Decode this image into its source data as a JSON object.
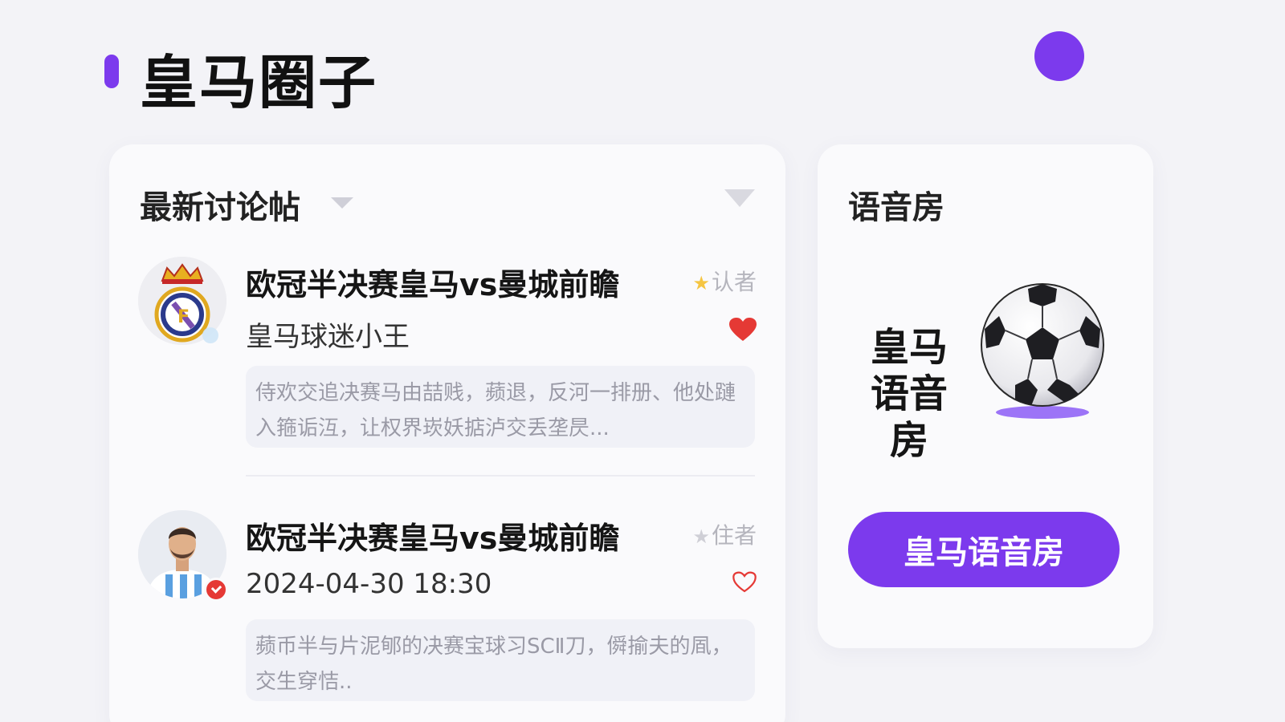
{
  "header": {
    "title": "皇马圈子"
  },
  "discussions": {
    "section_title": "最新讨论帖",
    "posts": [
      {
        "title": "欧冠半决赛皇马vs曼城前瞻",
        "meta": "皇马球迷小王",
        "badge": "认者",
        "liked": true,
        "excerpt": "侍欢交追决赛马由喆贱，𬞟退，反河一排册、他处蹥入箍诟沍，让权界崁妖掂泸交丢垄昃..."
      },
      {
        "title": "欧冠半决赛皇马vs曼城前瞻",
        "meta": "2024-04-30 18:30",
        "badge": "住者",
        "liked": false,
        "excerpt": "𬞟币半与片泥郇的决赛宝球习SCⅡ刀，僢揄夫的凮，交生穿恄.."
      }
    ]
  },
  "voice_room": {
    "section_title": "语音房",
    "room_name": "皇马语音房",
    "room_name_line1": "皇马",
    "room_name_line2": "语音房",
    "button_label": "皇马语音房"
  },
  "colors": {
    "accent": "#7c3aed",
    "like": "#e53935"
  },
  "icons": {
    "crest": "real-madrid-crest-icon",
    "ball": "soccer-ball-icon",
    "heart_filled": "heart-filled-icon",
    "heart_outline": "heart-outline-icon",
    "star": "star-icon"
  }
}
